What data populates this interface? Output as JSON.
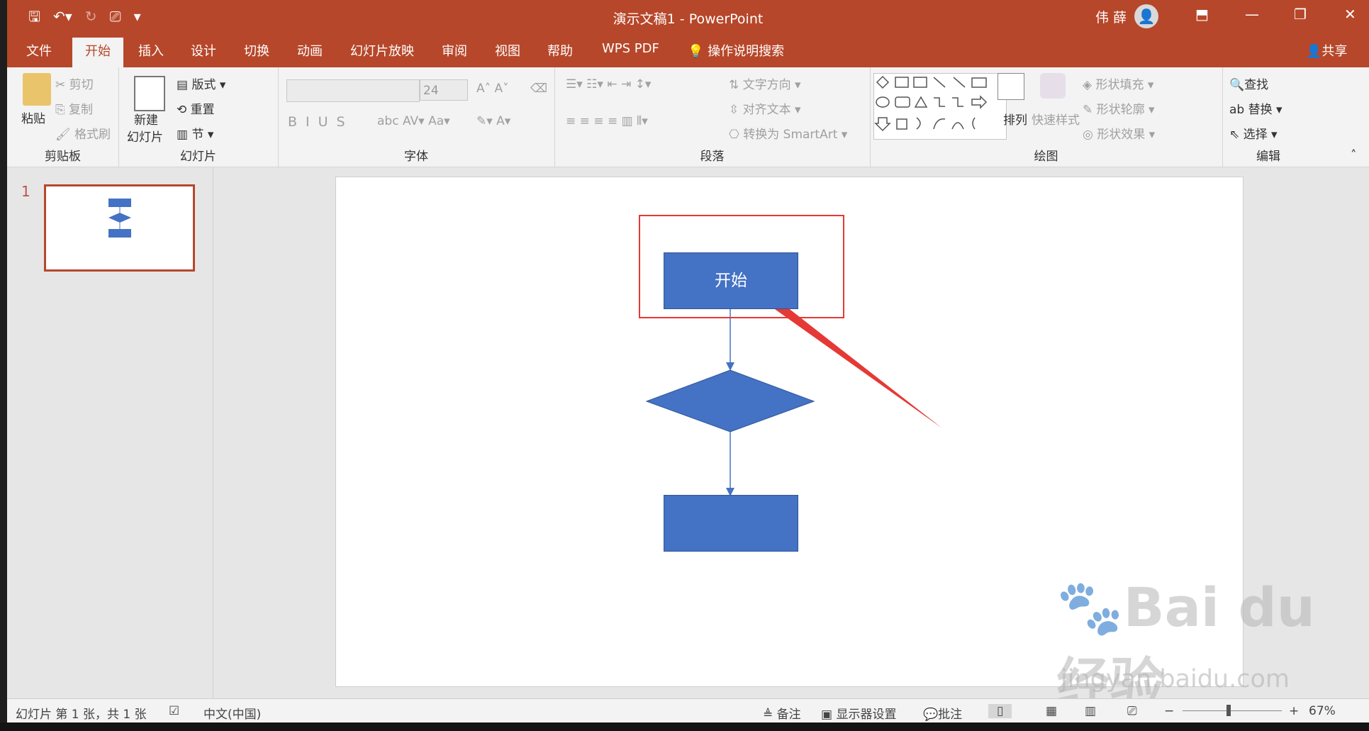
{
  "window": {
    "title": "演示文稿1 - PowerPoint",
    "user": "伟 薛"
  },
  "qat": {
    "save": "save-icon",
    "undo": "undo-icon",
    "redo": "redo-icon",
    "present": "present-icon",
    "more": "▾"
  },
  "tabs": [
    "文件",
    "开始",
    "插入",
    "设计",
    "切换",
    "动画",
    "幻灯片放映",
    "审阅",
    "视图",
    "帮助",
    "WPS PDF"
  ],
  "active_tab": "开始",
  "tell_me": "操作说明搜索",
  "share": "共享",
  "ribbon": {
    "clipboard": {
      "label": "剪贴板",
      "paste": "粘贴",
      "cut": "剪切",
      "copy": "复制",
      "format_painter": "格式刷"
    },
    "slides": {
      "label": "幻灯片",
      "new_slide_line1": "新建",
      "new_slide_line2": "幻灯片",
      "layout": "版式",
      "reset": "重置",
      "section": "节"
    },
    "font": {
      "label": "字体",
      "font_name": "",
      "font_size": "24"
    },
    "paragraph": {
      "label": "段落",
      "text_direction": "文字方向",
      "align_text": "对齐文本",
      "convert_smartart": "转换为 SmartArt"
    },
    "drawing": {
      "label": "绘图",
      "arrange": "排列",
      "quick_styles": "快速样式",
      "shape_fill": "形状填充",
      "shape_outline": "形状轮廓",
      "shape_effects": "形状效果"
    },
    "editing": {
      "label": "编辑",
      "find": "查找",
      "replace": "替换",
      "select": "选择"
    }
  },
  "slide_panel": {
    "slide_number": "1"
  },
  "slide": {
    "start_text": "开始"
  },
  "colors": {
    "accent": "#b7472a",
    "shape_fill": "#4472c4",
    "annotation": "#e53935"
  },
  "status": {
    "slide_info": "幻灯片 第 1 张，共 1 张",
    "language": "中文(中国)",
    "notes": "备注",
    "display_settings": "显示器设置",
    "comments": "批注",
    "zoom": "67%"
  },
  "watermark": {
    "line1": "Bai du 经验",
    "line2": "jingyan.baidu.com"
  }
}
